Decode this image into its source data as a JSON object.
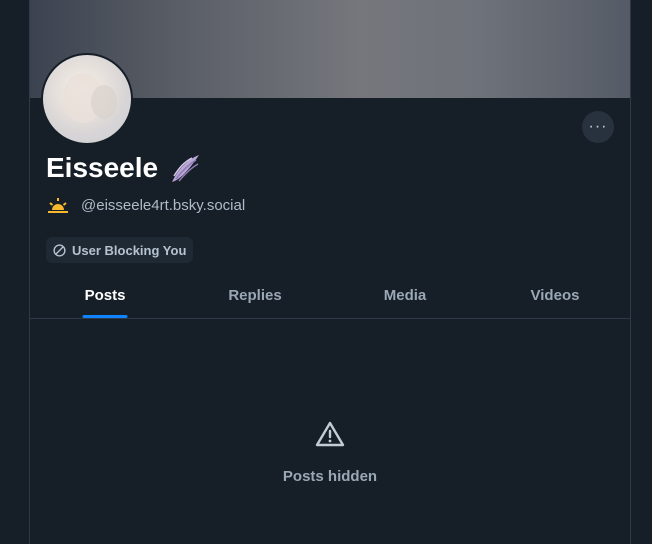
{
  "profile": {
    "display_name": "Eisseele",
    "handle": "@eisseele4rt.bsky.social",
    "more_label": "···"
  },
  "badge": {
    "label": "User Blocking You"
  },
  "tabs": [
    {
      "label": "Posts",
      "active": true
    },
    {
      "label": "Replies",
      "active": false
    },
    {
      "label": "Media",
      "active": false
    },
    {
      "label": "Videos",
      "active": false
    }
  ],
  "empty_state": {
    "message": "Posts hidden"
  },
  "colors": {
    "accent": "#1083fe",
    "background": "#161e27"
  }
}
